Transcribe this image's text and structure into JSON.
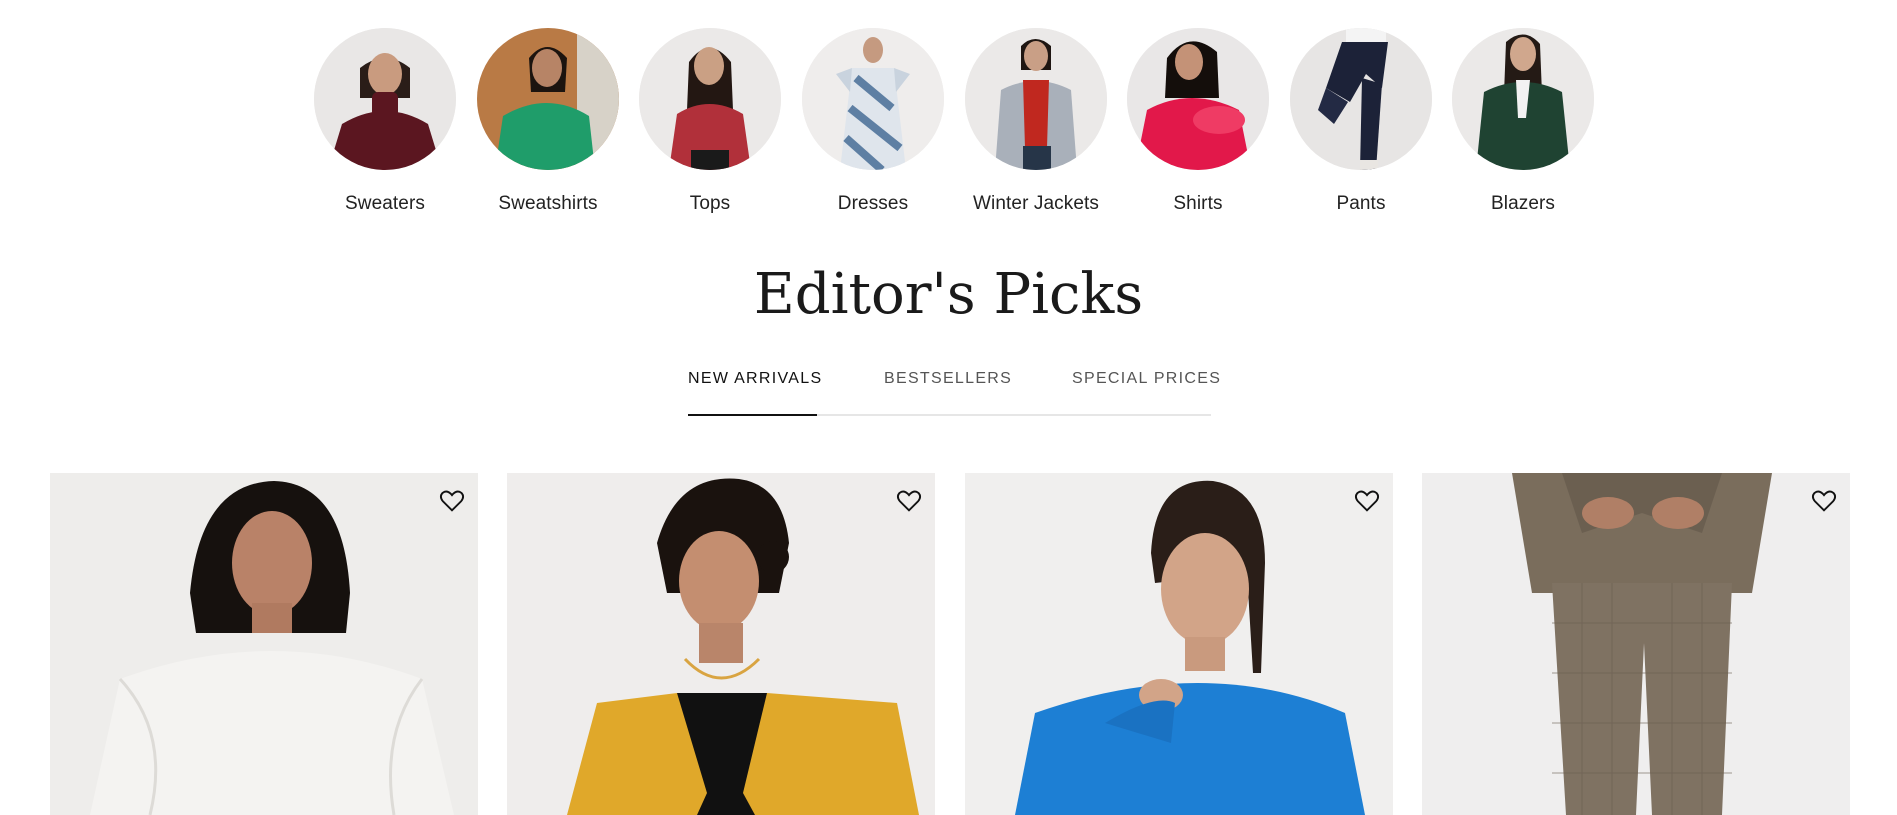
{
  "categories": [
    {
      "label": "Sweaters",
      "color": "#5b1620",
      "icon": "sweater-model-photo"
    },
    {
      "label": "Sweatshirts",
      "color": "#1f9d6a",
      "icon": "sweatshirt-model-photo"
    },
    {
      "label": "Tops",
      "color": "#b1303a",
      "icon": "top-model-photo"
    },
    {
      "label": "Dresses",
      "color": "#5e7fa3",
      "icon": "dress-model-photo"
    },
    {
      "label": "Winter Jackets",
      "color": "#a9b0ba",
      "icon": "jacket-model-photo"
    },
    {
      "label": "Shirts",
      "color": "#e2184a",
      "icon": "shirt-model-photo"
    },
    {
      "label": "Pants",
      "color": "#1c2238",
      "icon": "pants-model-photo"
    },
    {
      "label": "Blazers",
      "color": "#1f4332",
      "icon": "blazer-model-photo"
    }
  ],
  "section": {
    "title": "Editor's Picks"
  },
  "tabs": [
    {
      "label": "NEW ARRIVALS",
      "active": true
    },
    {
      "label": "BESTSELLERS",
      "active": false
    },
    {
      "label": "SPECIAL PRICES",
      "active": false
    }
  ],
  "products": [
    {
      "garment_color": "#f4f3f1",
      "icon": "white-sweatshirt-photo"
    },
    {
      "garment_color": "#e0a82a",
      "icon": "mustard-blazer-photo"
    },
    {
      "garment_color": "#1d7fd4",
      "icon": "blue-sweatshirt-photo"
    },
    {
      "garment_color": "#7a6d5c",
      "icon": "check-suit-photo"
    }
  ]
}
